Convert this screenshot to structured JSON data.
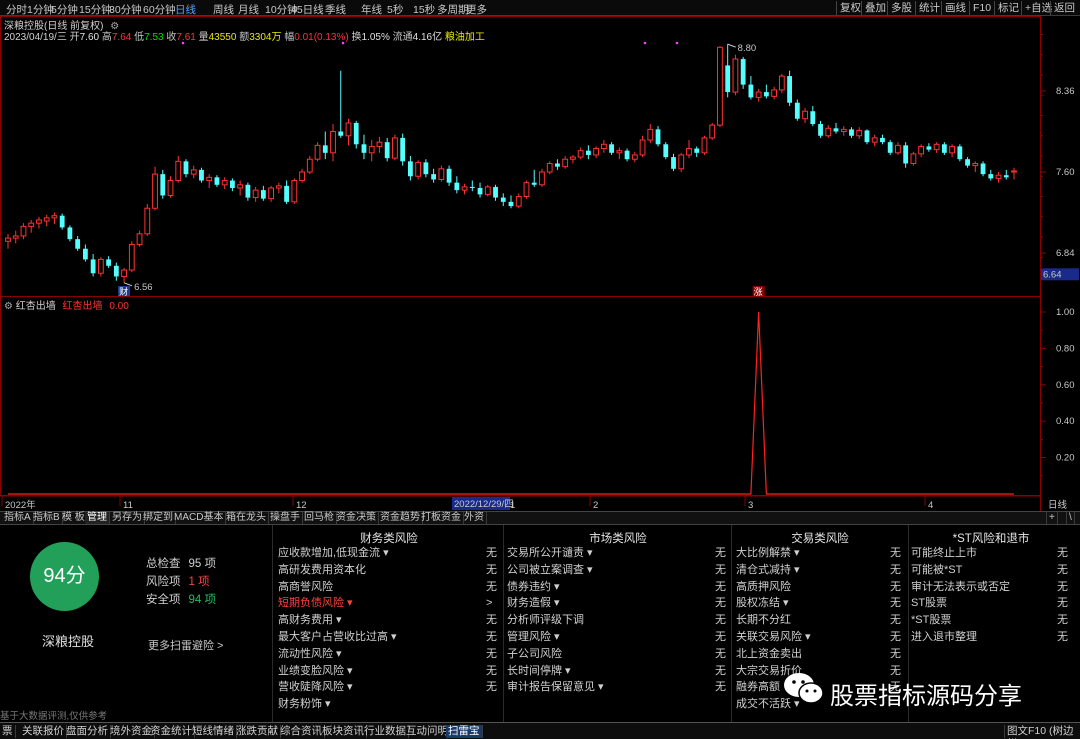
{
  "top_periods": [
    "分时",
    "1分钟",
    "5分钟",
    "15分钟",
    "30分钟",
    "60分钟",
    "日线",
    "周线",
    "月线",
    "10分钟",
    "45日线",
    "季线",
    "年线",
    "5秒",
    "15秒",
    "多周期",
    "更多"
  ],
  "top_active": "日线",
  "top_right_buttons": [
    "复权",
    "叠加",
    "多股",
    "统计",
    "画线",
    "F10",
    "标记",
    "+自选",
    "返回"
  ],
  "info": {
    "title": "深粮控股(日线 前复权)",
    "date": "2023/04/19/三",
    "open_label": "开",
    "open": "7.60",
    "high_label": "高",
    "high": "7.64",
    "low_label": "低",
    "low": "7.53",
    "close_label": "收",
    "close": "7.61",
    "vol_label": "量",
    "vol": "43550",
    "amt_label": "额",
    "amt": "3304万",
    "chg_label": "幅",
    "chg": "0.01(0.13%)",
    "turn_label": "换",
    "turn": "1.05%",
    "float_label": "流通",
    "float": "4.16亿",
    "industry": "粮油加工"
  },
  "price_axis": [
    "8.36",
    "7.60",
    "6.84"
  ],
  "price_current_tag": "6.64",
  "high_marker": "8.80",
  "low_marker": "6.56",
  "marker_cai": "财",
  "marker_zhang": "涨",
  "indicator": {
    "name": "红杏出墙",
    "name2": "红杏出墙",
    "value": "0.00"
  },
  "indicator_axis": [
    "1.00",
    "0.80",
    "0.60",
    "0.40",
    "0.20"
  ],
  "date_axis": {
    "labels": [
      "2022年",
      "11",
      "12",
      "1",
      "2",
      "3",
      "4"
    ],
    "cursor": "2022/12/29/四",
    "right": "日线"
  },
  "chart_data": {
    "type": "candlestick",
    "symbol": "深粮控股",
    "indicator_series": {
      "name": "红杏出墙",
      "spike_value": 1.0,
      "spike_index": 97
    },
    "candles": [
      [
        6.95,
        7.02,
        6.88,
        6.98
      ],
      [
        6.98,
        7.05,
        6.93,
        7.0
      ],
      [
        7.0,
        7.12,
        6.97,
        7.09
      ],
      [
        7.09,
        7.15,
        7.03,
        7.12
      ],
      [
        7.12,
        7.18,
        7.07,
        7.15
      ],
      [
        7.14,
        7.2,
        7.09,
        7.17
      ],
      [
        7.17,
        7.22,
        7.11,
        7.19
      ],
      [
        7.19,
        7.21,
        7.06,
        7.08
      ],
      [
        7.08,
        7.1,
        6.95,
        6.97
      ],
      [
        6.97,
        7.0,
        6.86,
        6.88
      ],
      [
        6.88,
        6.92,
        6.76,
        6.78
      ],
      [
        6.78,
        6.83,
        6.62,
        6.65
      ],
      [
        6.65,
        6.8,
        6.62,
        6.78
      ],
      [
        6.78,
        6.81,
        6.7,
        6.72
      ],
      [
        6.72,
        6.75,
        6.58,
        6.62
      ],
      [
        6.62,
        6.7,
        6.56,
        6.68
      ],
      [
        6.68,
        6.95,
        6.66,
        6.92
      ],
      [
        6.92,
        7.05,
        6.9,
        7.02
      ],
      [
        7.02,
        7.3,
        7.0,
        7.26
      ],
      [
        7.26,
        7.65,
        7.24,
        7.58
      ],
      [
        7.58,
        7.62,
        7.35,
        7.38
      ],
      [
        7.38,
        7.56,
        7.36,
        7.52
      ],
      [
        7.52,
        7.75,
        7.5,
        7.7
      ],
      [
        7.7,
        7.72,
        7.55,
        7.58
      ],
      [
        7.58,
        7.66,
        7.54,
        7.62
      ],
      [
        7.62,
        7.64,
        7.5,
        7.52
      ],
      [
        7.52,
        7.58,
        7.45,
        7.55
      ],
      [
        7.55,
        7.57,
        7.46,
        7.48
      ],
      [
        7.48,
        7.55,
        7.44,
        7.52
      ],
      [
        7.52,
        7.54,
        7.42,
        7.45
      ],
      [
        7.45,
        7.52,
        7.38,
        7.48
      ],
      [
        7.48,
        7.5,
        7.33,
        7.36
      ],
      [
        7.36,
        7.46,
        7.32,
        7.43
      ],
      [
        7.43,
        7.47,
        7.33,
        7.35
      ],
      [
        7.35,
        7.47,
        7.32,
        7.45
      ],
      [
        7.45,
        7.5,
        7.4,
        7.47
      ],
      [
        7.47,
        7.52,
        7.3,
        7.32
      ],
      [
        7.32,
        7.54,
        7.3,
        7.52
      ],
      [
        7.52,
        7.63,
        7.5,
        7.6
      ],
      [
        7.6,
        7.75,
        7.58,
        7.72
      ],
      [
        7.72,
        7.88,
        7.7,
        7.85
      ],
      [
        7.85,
        7.98,
        7.72,
        7.78
      ],
      [
        7.78,
        8.05,
        7.7,
        7.98
      ],
      [
        7.98,
        8.55,
        7.92,
        7.94
      ],
      [
        7.94,
        8.1,
        7.85,
        8.06
      ],
      [
        8.06,
        8.08,
        7.82,
        7.86
      ],
      [
        7.86,
        7.95,
        7.72,
        7.78
      ],
      [
        7.78,
        7.9,
        7.7,
        7.84
      ],
      [
        7.84,
        7.93,
        7.78,
        7.88
      ],
      [
        7.88,
        7.92,
        7.7,
        7.73
      ],
      [
        7.73,
        7.95,
        7.71,
        7.92
      ],
      [
        7.92,
        7.96,
        7.66,
        7.7
      ],
      [
        7.7,
        7.75,
        7.52,
        7.56
      ],
      [
        7.56,
        7.71,
        7.53,
        7.69
      ],
      [
        7.69,
        7.72,
        7.55,
        7.58
      ],
      [
        7.58,
        7.63,
        7.5,
        7.53
      ],
      [
        7.53,
        7.66,
        7.51,
        7.63
      ],
      [
        7.63,
        7.66,
        7.47,
        7.5
      ],
      [
        7.5,
        7.56,
        7.4,
        7.43
      ],
      [
        7.43,
        7.49,
        7.39,
        7.46
      ],
      [
        7.46,
        7.52,
        7.42,
        7.45
      ],
      [
        7.45,
        7.5,
        7.36,
        7.39
      ],
      [
        7.39,
        7.48,
        7.37,
        7.46
      ],
      [
        7.46,
        7.48,
        7.33,
        7.36
      ],
      [
        7.36,
        7.4,
        7.28,
        7.32
      ],
      [
        7.32,
        7.38,
        7.26,
        7.28
      ],
      [
        7.28,
        7.4,
        7.26,
        7.37
      ],
      [
        7.37,
        7.52,
        7.35,
        7.5
      ],
      [
        7.5,
        7.62,
        7.46,
        7.48
      ],
      [
        7.48,
        7.63,
        7.46,
        7.6
      ],
      [
        7.6,
        7.7,
        7.58,
        7.68
      ],
      [
        7.68,
        7.72,
        7.62,
        7.65
      ],
      [
        7.65,
        7.75,
        7.63,
        7.72
      ],
      [
        7.72,
        7.76,
        7.68,
        7.74
      ],
      [
        7.74,
        7.83,
        7.72,
        7.8
      ],
      [
        7.8,
        7.85,
        7.72,
        7.76
      ],
      [
        7.76,
        7.84,
        7.73,
        7.82
      ],
      [
        7.82,
        7.9,
        7.78,
        7.86
      ],
      [
        7.86,
        7.88,
        7.76,
        7.78
      ],
      [
        7.78,
        7.83,
        7.72,
        7.8
      ],
      [
        7.8,
        7.82,
        7.7,
        7.72
      ],
      [
        7.72,
        7.79,
        7.69,
        7.76
      ],
      [
        7.76,
        7.94,
        7.74,
        7.9
      ],
      [
        7.9,
        8.05,
        7.87,
        8.0
      ],
      [
        8.0,
        8.03,
        7.84,
        7.86
      ],
      [
        7.86,
        7.88,
        7.72,
        7.74
      ],
      [
        7.74,
        7.77,
        7.61,
        7.63
      ],
      [
        7.63,
        7.78,
        7.6,
        7.76
      ],
      [
        7.76,
        7.9,
        7.73,
        7.82
      ],
      [
        7.82,
        7.84,
        7.74,
        7.78
      ],
      [
        7.78,
        7.94,
        7.76,
        7.92
      ],
      [
        7.92,
        8.06,
        7.9,
        8.04
      ],
      [
        8.04,
        8.78,
        8.02,
        8.77
      ],
      [
        8.6,
        8.8,
        8.3,
        8.35
      ],
      [
        8.35,
        8.7,
        8.32,
        8.66
      ],
      [
        8.66,
        8.68,
        8.38,
        8.42
      ],
      [
        8.42,
        8.5,
        8.28,
        8.3
      ],
      [
        8.3,
        8.38,
        8.26,
        8.35
      ],
      [
        8.35,
        8.42,
        8.29,
        8.31
      ],
      [
        8.31,
        8.4,
        8.28,
        8.37
      ],
      [
        8.37,
        8.52,
        8.34,
        8.5
      ],
      [
        8.5,
        8.55,
        8.22,
        8.25
      ],
      [
        8.25,
        8.28,
        8.08,
        8.1
      ],
      [
        8.1,
        8.2,
        8.06,
        8.17
      ],
      [
        8.17,
        8.22,
        8.03,
        8.05
      ],
      [
        8.05,
        8.08,
        7.92,
        7.94
      ],
      [
        7.94,
        8.04,
        7.92,
        8.01
      ],
      [
        8.01,
        8.06,
        7.96,
        7.98
      ],
      [
        7.98,
        8.03,
        7.94,
        8.0
      ],
      [
        8.0,
        8.02,
        7.92,
        7.94
      ],
      [
        7.94,
        8.02,
        7.91,
        7.99
      ],
      [
        7.99,
        8.0,
        7.86,
        7.88
      ],
      [
        7.88,
        7.95,
        7.84,
        7.92
      ],
      [
        7.92,
        7.95,
        7.86,
        7.88
      ],
      [
        7.88,
        7.9,
        7.76,
        7.78
      ],
      [
        7.78,
        7.88,
        7.76,
        7.85
      ],
      [
        7.85,
        7.88,
        7.64,
        7.68
      ],
      [
        7.68,
        7.79,
        7.66,
        7.77
      ],
      [
        7.77,
        7.86,
        7.74,
        7.84
      ],
      [
        7.84,
        7.87,
        7.79,
        7.81
      ],
      [
        7.81,
        7.88,
        7.78,
        7.86
      ],
      [
        7.86,
        7.88,
        7.76,
        7.78
      ],
      [
        7.78,
        7.86,
        7.74,
        7.84
      ],
      [
        7.84,
        7.86,
        7.7,
        7.72
      ],
      [
        7.72,
        7.74,
        7.64,
        7.66
      ],
      [
        7.66,
        7.7,
        7.6,
        7.68
      ],
      [
        7.68,
        7.7,
        7.56,
        7.58
      ],
      [
        7.58,
        7.62,
        7.52,
        7.54
      ],
      [
        7.54,
        7.6,
        7.5,
        7.57
      ],
      [
        7.57,
        7.62,
        7.53,
        7.55
      ],
      [
        7.6,
        7.64,
        7.53,
        7.61
      ]
    ]
  },
  "tabs": [
    "指标A",
    "指标B",
    "模 板",
    "管理",
    "另存为",
    "绑定到",
    "MACD基本",
    "箱在龙头",
    "操盘手",
    "回马枪",
    "资金决策",
    "资金趋势",
    "打板资金",
    "外资"
  ],
  "tabs_active": "管理",
  "tab_right": [
    "+",
    "\\"
  ],
  "panel": {
    "score": "94分",
    "company": "深粮控股",
    "total_label": "总检查",
    "total_val": "95 项",
    "risk_label": "风险项",
    "risk_val": "1 项",
    "safe_label": "安全项",
    "safe_val": "94 项",
    "more": "更多扫雷避险 >",
    "disclaimer": "基于大数据评测,仅供参考",
    "columns": [
      {
        "title": "财务类风险",
        "items": [
          [
            "应收款增加,低现金流 ▾",
            "无"
          ],
          [
            "高研发费用资本化",
            "无"
          ],
          [
            "高商誉风险",
            "无"
          ],
          [
            "短期负债风险 ▾",
            ">"
          ],
          [
            "高财务费用 ▾",
            "无"
          ],
          [
            "最大客户占营收比过高 ▾",
            "无"
          ],
          [
            "流动性风险 ▾",
            "无"
          ],
          [
            "业绩变脸风险 ▾",
            "无"
          ],
          [
            "营收陡降风险 ▾",
            "无"
          ],
          [
            "财务粉饰 ▾",
            ""
          ]
        ]
      },
      {
        "title": "市场类风险",
        "items": [
          [
            "交易所公开谴责 ▾",
            "无"
          ],
          [
            "公司被立案调查 ▾",
            "无"
          ],
          [
            "债券违约 ▾",
            "无"
          ],
          [
            "财务造假 ▾",
            "无"
          ],
          [
            "分析师评级下调",
            "无"
          ],
          [
            "管理风险 ▾",
            "无"
          ],
          [
            "子公司风险",
            "无"
          ],
          [
            "长时间停牌 ▾",
            "无"
          ],
          [
            "审计报告保留意见 ▾",
            "无"
          ]
        ]
      },
      {
        "title": "交易类风险",
        "items": [
          [
            "大比例解禁 ▾",
            "无"
          ],
          [
            "清仓式减持 ▾",
            "无"
          ],
          [
            "高质押风险",
            "无"
          ],
          [
            "股权冻结 ▾",
            "无"
          ],
          [
            "长期不分红",
            "无"
          ],
          [
            "关联交易风险 ▾",
            "无"
          ],
          [
            "北上资金卖出",
            "无"
          ],
          [
            "大宗交易折价",
            "无"
          ],
          [
            "融券高额",
            "无"
          ],
          [
            "成交不活跃 ▾",
            ""
          ]
        ]
      },
      {
        "title": "*ST风险和退市",
        "items": [
          [
            "可能终止上市",
            "无"
          ],
          [
            "可能被*ST",
            "无"
          ],
          [
            "审计无法表示或否定",
            "无"
          ],
          [
            "ST股票",
            "无"
          ],
          [
            "*ST股票",
            "无"
          ],
          [
            "进入退市整理",
            "无"
          ]
        ]
      }
    ]
  },
  "statusbar": [
    "票",
    "关联报价",
    "盘面分析",
    "境外资金",
    "资金统计",
    "短线情绪",
    "涨跌贡献",
    "综合资讯",
    "板块资讯",
    "行业数据",
    "互动问明",
    "扫雷宝"
  ],
  "statusbar_active": "扫雷宝",
  "statusbar_right": "图文F10 (树边栏)",
  "watermark": "股票指标源码分享",
  "colors": {
    "up": "#ff3232",
    "down": "#54ffff",
    "frame": "#8b0000",
    "accent": "#4fa3ff",
    "score_green": "#22a05a"
  }
}
